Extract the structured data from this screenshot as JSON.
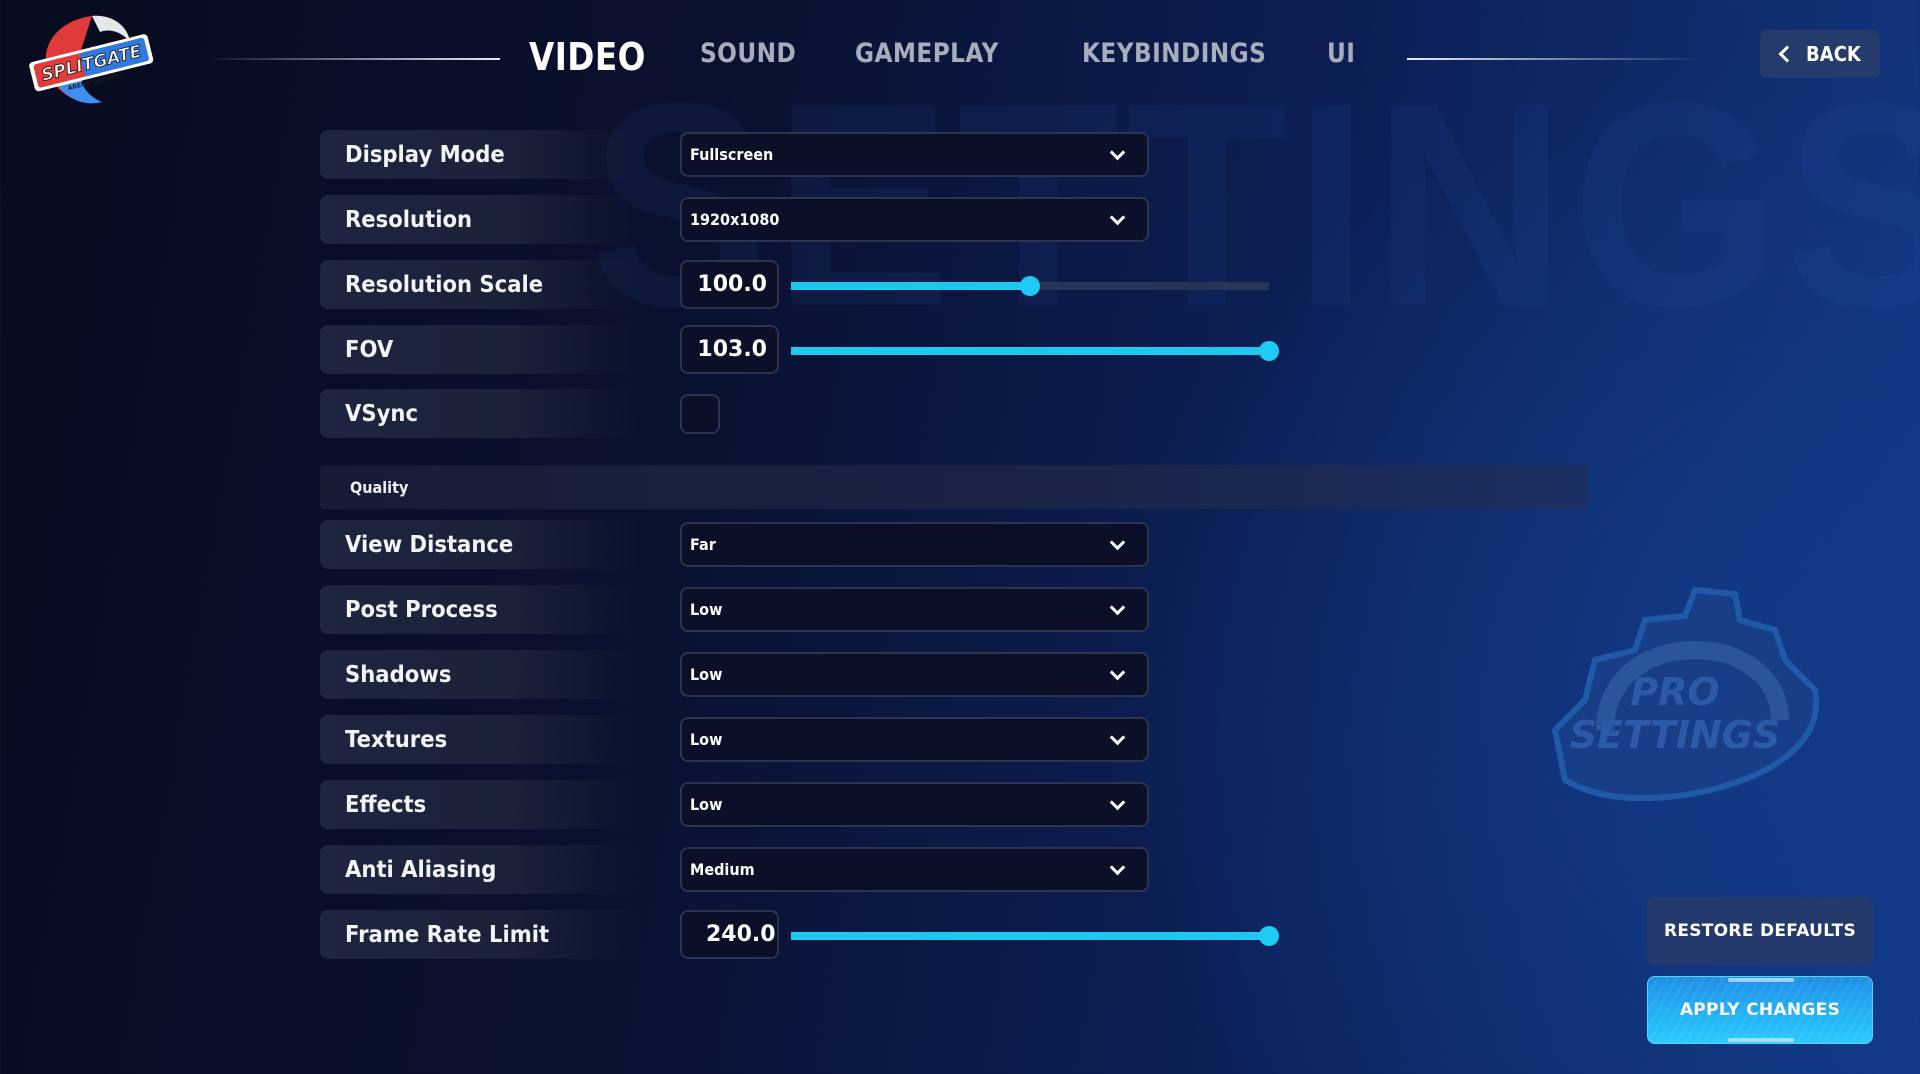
{
  "watermark": "SETTINGS",
  "logo": {
    "name": "SPLITGATE",
    "subtitle": "ARENA WARFARE"
  },
  "nav": {
    "tabs": [
      {
        "label": "VIDEO",
        "active": true
      },
      {
        "label": "SOUND",
        "active": false
      },
      {
        "label": "GAMEPLAY",
        "active": false
      },
      {
        "label": "KEYBINDINGS",
        "active": false
      },
      {
        "label": "UI",
        "active": false
      }
    ],
    "back_label": "BACK"
  },
  "display": {
    "display_mode": {
      "label": "Display Mode",
      "value": "Fullscreen"
    },
    "resolution": {
      "label": "Resolution",
      "value": "1920x1080"
    },
    "resolution_scale": {
      "label": "Resolution Scale",
      "value": "100.0",
      "slider_fraction": 0.5
    },
    "fov": {
      "label": "FOV",
      "value": "103.0",
      "slider_fraction": 1.0
    },
    "vsync": {
      "label": "VSync",
      "checked": false
    }
  },
  "quality": {
    "section_label": "Quality",
    "view_distance": {
      "label": "View Distance",
      "value": "Far"
    },
    "post_process": {
      "label": "Post Process",
      "value": "Low"
    },
    "shadows": {
      "label": "Shadows",
      "value": "Low"
    },
    "textures": {
      "label": "Textures",
      "value": "Low"
    },
    "effects": {
      "label": "Effects",
      "value": "Low"
    },
    "anti_aliasing": {
      "label": "Anti Aliasing",
      "value": "Medium"
    },
    "frame_rate_limit": {
      "label": "Frame Rate Limit",
      "value": "240.0",
      "slider_fraction": 1.0
    }
  },
  "watermark_logo": {
    "line1": "PRO",
    "line2": "SETTINGS"
  },
  "actions": {
    "restore_label": "RESTORE DEFAULTS",
    "apply_label": "APPLY CHANGES"
  },
  "colors": {
    "accent": "#1ec8ee",
    "apply_button": "#22b4f6",
    "restore_button": "#243a6c"
  }
}
